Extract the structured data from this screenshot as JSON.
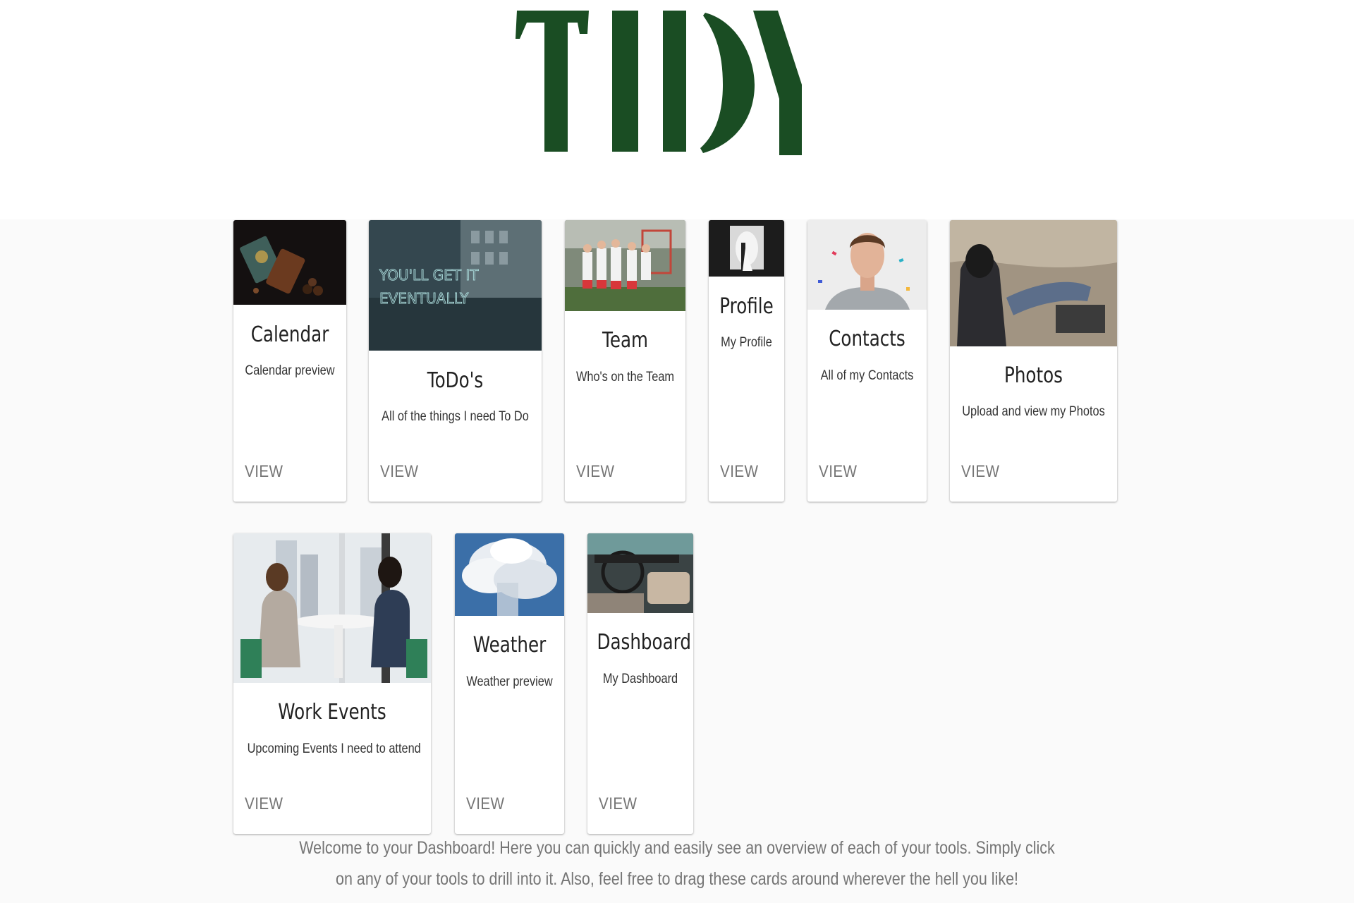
{
  "app": {
    "logo_text": "TIDY",
    "brand_color": "#1a4d23"
  },
  "cards": [
    {
      "title": "Calendar",
      "description": "Calendar preview",
      "action": "VIEW",
      "image": "quran-and-prayer-beads-photo"
    },
    {
      "title": "ToDo's",
      "description": "All of the things I need To Do",
      "action": "VIEW",
      "image": "neon-sign-you-will-get-it-eventually-photo"
    },
    {
      "title": "Team",
      "description": "Who's on the Team",
      "action": "VIEW",
      "image": "lacrosse-team-photo"
    },
    {
      "title": "Profile",
      "description": "My Profile",
      "action": "VIEW",
      "image": "couple-silhouette-photo"
    },
    {
      "title": "Contacts",
      "description": "All of my Contacts",
      "action": "VIEW",
      "image": "young-man-confetti-photo"
    },
    {
      "title": "Photos",
      "description": "Upload and view my Photos",
      "action": "VIEW",
      "image": "people-sitting-on-rocks-photo"
    },
    {
      "title": "Work Events",
      "description": "Upcoming Events I need to attend",
      "action": "VIEW",
      "image": "two-women-meeting-photo"
    },
    {
      "title": "Weather",
      "description": "Weather preview",
      "action": "VIEW",
      "image": "cloud-sky-photo"
    },
    {
      "title": "Dashboard",
      "description": "My Dashboard",
      "action": "VIEW",
      "image": "car-interior-dashboard-photo"
    }
  ],
  "footer": {
    "welcome_text": "Welcome to your Dashboard! Here you can quickly and easily see an overview of each of your tools. Simply click on any of your tools to drill into it. Also, feel free to drag these cards around wherever the hell you like!"
  }
}
